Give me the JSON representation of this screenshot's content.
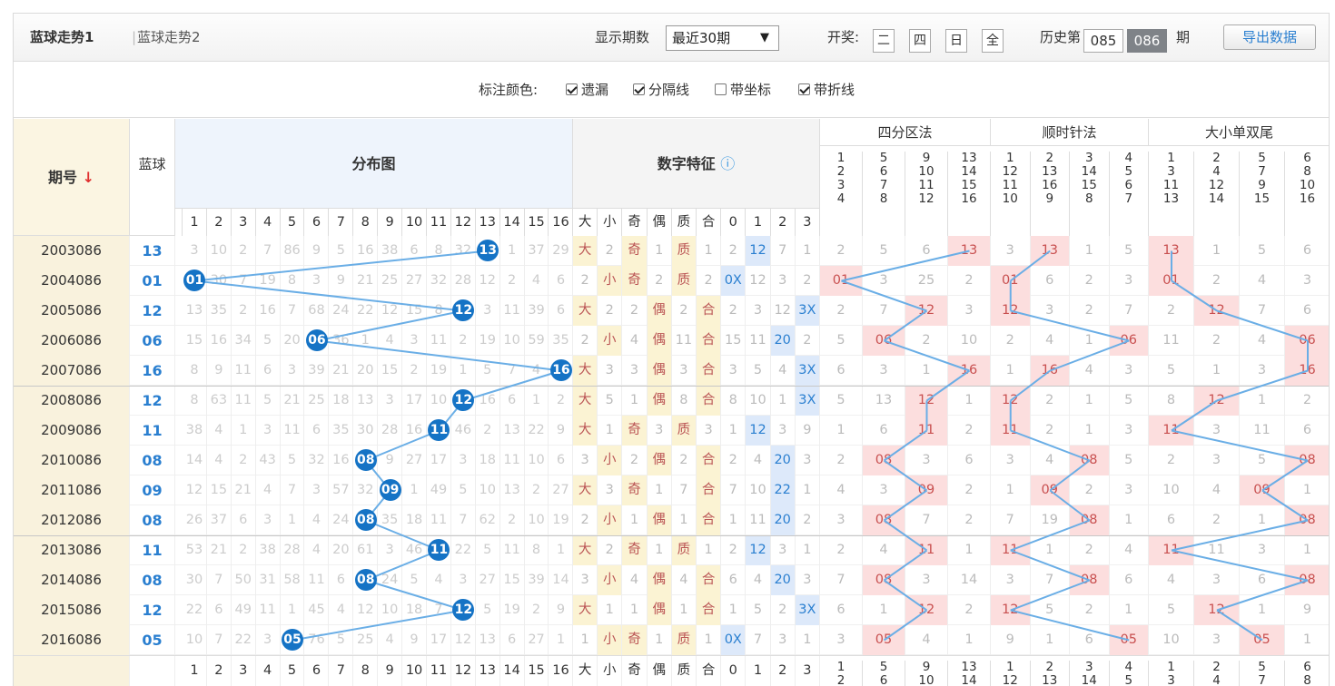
{
  "tabs": [
    "蓝球走势1",
    "蓝球走势2"
  ],
  "display": {
    "label": "显示期数",
    "value": "最近30期"
  },
  "draw": {
    "label": "开奖:",
    "days": [
      "二",
      "四",
      "日",
      "全"
    ]
  },
  "history": {
    "label": "历史第",
    "boxes": [
      "085",
      "086"
    ],
    "suffix": "期"
  },
  "export": "导出数据",
  "options": {
    "label": "标注颜色:",
    "items": [
      {
        "label": "遗漏",
        "on": true
      },
      {
        "label": "分隔线",
        "on": true
      },
      {
        "label": "带坐标",
        "on": false
      },
      {
        "label": "带折线",
        "on": true
      }
    ]
  },
  "header": {
    "period": "期号",
    "blue": "蓝球",
    "dist": "分布图",
    "feat": "数字特征",
    "zone4": "四分区法",
    "clock": "顺时针法",
    "bigsmall": "大小单双尾",
    "nums": [
      "1",
      "2",
      "3",
      "4",
      "5",
      "6",
      "7",
      "8",
      "9",
      "10",
      "11",
      "12",
      "13",
      "14",
      "15",
      "16"
    ],
    "feats": [
      "大",
      "小",
      "奇",
      "偶",
      "质",
      "合",
      "0",
      "1",
      "2",
      "3"
    ],
    "zones4": [
      [
        "1",
        "2",
        "3",
        "4"
      ],
      [
        "5",
        "6",
        "7",
        "8"
      ],
      [
        "9",
        "10",
        "11",
        "12"
      ],
      [
        "13",
        "14",
        "15",
        "16"
      ]
    ],
    "clocks": [
      [
        "1",
        "12",
        "11",
        "10"
      ],
      [
        "2",
        "13",
        "16",
        "9"
      ],
      [
        "3",
        "14",
        "15",
        "8"
      ],
      [
        "4",
        "5",
        "6",
        "7"
      ]
    ],
    "tails": [
      [
        "1",
        "3",
        "11",
        "13"
      ],
      [
        "2",
        "4",
        "12",
        "14"
      ],
      [
        "5",
        "7",
        "9",
        "15"
      ],
      [
        "6",
        "8",
        "10",
        "16"
      ]
    ]
  },
  "rows": [
    {
      "p": "2003086",
      "b": "13",
      "d": [
        "3",
        "10",
        "2",
        "7",
        "86",
        "9",
        "5",
        "16",
        "38",
        "6",
        "8",
        "32",
        "13",
        "1",
        "37",
        "29"
      ],
      "f": [
        "大",
        "2",
        "奇",
        "1",
        "质",
        "1",
        "2",
        "12",
        "7",
        "1"
      ],
      "z": [
        "2",
        "5",
        "6",
        "13"
      ],
      "c": [
        "3",
        "13",
        "1",
        "5"
      ],
      "t": [
        "13",
        "1",
        "5",
        "6"
      ]
    },
    {
      "p": "2004086",
      "b": "01",
      "d": [
        "01",
        "30",
        "7",
        "19",
        "8",
        "3",
        "9",
        "21",
        "25",
        "27",
        "32",
        "28",
        "12",
        "2",
        "4",
        "6"
      ],
      "f": [
        "2",
        "小",
        "奇",
        "2",
        "质",
        "2",
        "0X",
        "12",
        "3",
        "2"
      ],
      "z": [
        "01",
        "3",
        "25",
        "2"
      ],
      "c": [
        "01",
        "6",
        "2",
        "3"
      ],
      "t": [
        "01",
        "2",
        "4",
        "3"
      ]
    },
    {
      "p": "2005086",
      "b": "12",
      "d": [
        "13",
        "35",
        "2",
        "16",
        "7",
        "68",
        "24",
        "22",
        "12",
        "15",
        "8",
        "12",
        "3",
        "11",
        "39",
        "6"
      ],
      "f": [
        "大",
        "2",
        "2",
        "偶",
        "2",
        "合",
        "2",
        "3",
        "12",
        "3X"
      ],
      "z": [
        "2",
        "7",
        "12",
        "3"
      ],
      "c": [
        "12",
        "3",
        "2",
        "7"
      ],
      "t": [
        "2",
        "12",
        "7",
        "6"
      ]
    },
    {
      "p": "2006086",
      "b": "06",
      "d": [
        "15",
        "16",
        "34",
        "5",
        "20",
        "06",
        "36",
        "1",
        "4",
        "3",
        "11",
        "2",
        "19",
        "10",
        "59",
        "35"
      ],
      "f": [
        "2",
        "小",
        "4",
        "偶",
        "11",
        "合",
        "15",
        "11",
        "20",
        "2"
      ],
      "z": [
        "5",
        "06",
        "2",
        "10"
      ],
      "c": [
        "2",
        "4",
        "1",
        "06"
      ],
      "t": [
        "11",
        "2",
        "4",
        "06"
      ]
    },
    {
      "p": "2007086",
      "b": "16",
      "d": [
        "8",
        "9",
        "11",
        "6",
        "3",
        "39",
        "21",
        "20",
        "15",
        "2",
        "19",
        "1",
        "5",
        "7",
        "4",
        "16"
      ],
      "f": [
        "大",
        "3",
        "3",
        "偶",
        "3",
        "合",
        "3",
        "5",
        "4",
        "3X"
      ],
      "z": [
        "6",
        "3",
        "1",
        "16"
      ],
      "c": [
        "1",
        "16",
        "4",
        "3"
      ],
      "t": [
        "5",
        "1",
        "3",
        "16"
      ]
    },
    {
      "p": "2008086",
      "b": "12",
      "d": [
        "8",
        "63",
        "11",
        "5",
        "21",
        "25",
        "18",
        "13",
        "3",
        "17",
        "10",
        "12",
        "16",
        "6",
        "1",
        "2"
      ],
      "f": [
        "大",
        "5",
        "1",
        "偶",
        "8",
        "合",
        "8",
        "10",
        "1",
        "3X"
      ],
      "z": [
        "5",
        "13",
        "12",
        "1"
      ],
      "c": [
        "12",
        "2",
        "1",
        "5"
      ],
      "t": [
        "8",
        "12",
        "1",
        "2"
      ]
    },
    {
      "p": "2009086",
      "b": "11",
      "d": [
        "38",
        "4",
        "1",
        "3",
        "11",
        "6",
        "35",
        "30",
        "28",
        "16",
        "11",
        "46",
        "2",
        "13",
        "22",
        "9"
      ],
      "f": [
        "大",
        "1",
        "奇",
        "3",
        "质",
        "3",
        "1",
        "12",
        "3",
        "9"
      ],
      "z": [
        "1",
        "6",
        "11",
        "2"
      ],
      "c": [
        "11",
        "2",
        "1",
        "3"
      ],
      "t": [
        "11",
        "3",
        "11",
        "6"
      ]
    },
    {
      "p": "2010086",
      "b": "08",
      "d": [
        "14",
        "4",
        "2",
        "43",
        "5",
        "32",
        "16",
        "08",
        "9",
        "27",
        "17",
        "3",
        "18",
        "11",
        "10",
        "6"
      ],
      "f": [
        "3",
        "小",
        "2",
        "偶",
        "2",
        "合",
        "2",
        "4",
        "20",
        "3"
      ],
      "z": [
        "2",
        "08",
        "3",
        "6"
      ],
      "c": [
        "3",
        "4",
        "08",
        "5"
      ],
      "t": [
        "2",
        "3",
        "5",
        "08"
      ]
    },
    {
      "p": "2011086",
      "b": "09",
      "d": [
        "12",
        "15",
        "21",
        "4",
        "7",
        "3",
        "57",
        "32",
        "09",
        "1",
        "49",
        "5",
        "10",
        "13",
        "2",
        "27"
      ],
      "f": [
        "大",
        "3",
        "奇",
        "1",
        "7",
        "合",
        "7",
        "10",
        "22",
        "1"
      ],
      "z": [
        "4",
        "3",
        "09",
        "2"
      ],
      "c": [
        "1",
        "09",
        "2",
        "3"
      ],
      "t": [
        "10",
        "4",
        "09",
        "1"
      ]
    },
    {
      "p": "2012086",
      "b": "08",
      "d": [
        "26",
        "37",
        "6",
        "3",
        "1",
        "4",
        "24",
        "08",
        "35",
        "18",
        "11",
        "7",
        "62",
        "2",
        "10",
        "19"
      ],
      "f": [
        "2",
        "小",
        "1",
        "偶",
        "1",
        "合",
        "1",
        "11",
        "20",
        "2"
      ],
      "z": [
        "3",
        "08",
        "7",
        "2"
      ],
      "c": [
        "7",
        "19",
        "08",
        "1"
      ],
      "t": [
        "6",
        "2",
        "1",
        "08"
      ]
    },
    {
      "p": "2013086",
      "b": "11",
      "d": [
        "53",
        "21",
        "2",
        "38",
        "28",
        "4",
        "20",
        "61",
        "3",
        "46",
        "11",
        "22",
        "5",
        "11",
        "8",
        "1"
      ],
      "f": [
        "大",
        "2",
        "奇",
        "1",
        "质",
        "1",
        "2",
        "12",
        "3",
        "1"
      ],
      "z": [
        "2",
        "4",
        "11",
        "1"
      ],
      "c": [
        "11",
        "1",
        "2",
        "4"
      ],
      "t": [
        "11",
        "11",
        "3",
        "1"
      ]
    },
    {
      "p": "2014086",
      "b": "08",
      "d": [
        "30",
        "7",
        "50",
        "31",
        "58",
        "11",
        "6",
        "08",
        "24",
        "5",
        "4",
        "3",
        "27",
        "15",
        "39",
        "14"
      ],
      "f": [
        "3",
        "小",
        "4",
        "偶",
        "4",
        "合",
        "6",
        "4",
        "20",
        "3"
      ],
      "z": [
        "7",
        "08",
        "3",
        "14"
      ],
      "c": [
        "3",
        "7",
        "08",
        "6"
      ],
      "t": [
        "4",
        "3",
        "6",
        "08"
      ]
    },
    {
      "p": "2015086",
      "b": "12",
      "d": [
        "22",
        "6",
        "49",
        "11",
        "1",
        "45",
        "4",
        "12",
        "10",
        "18",
        "7",
        "12",
        "5",
        "19",
        "2",
        "9"
      ],
      "f": [
        "大",
        "1",
        "1",
        "偶",
        "1",
        "合",
        "1",
        "5",
        "2",
        "3X"
      ],
      "z": [
        "6",
        "1",
        "12",
        "2"
      ],
      "c": [
        "12",
        "5",
        "2",
        "1"
      ],
      "t": [
        "5",
        "12",
        "1",
        "9"
      ]
    },
    {
      "p": "2016086",
      "b": "05",
      "d": [
        "10",
        "7",
        "22",
        "3",
        "05",
        "76",
        "5",
        "25",
        "4",
        "9",
        "17",
        "12",
        "13",
        "6",
        "27",
        "1"
      ],
      "f": [
        "1",
        "小",
        "奇",
        "1",
        "质",
        "1",
        "0X",
        "7",
        "3",
        "1"
      ],
      "z": [
        "3",
        "05",
        "4",
        "1"
      ],
      "c": [
        "9",
        "1",
        "6",
        "05"
      ],
      "t": [
        "10",
        "3",
        "05",
        "1"
      ]
    }
  ],
  "hits": {
    "ball": [
      13,
      1,
      12,
      6,
      16,
      12,
      11,
      8,
      9,
      8,
      11,
      8,
      12,
      5
    ],
    "feat": [
      [
        0,
        2,
        4,
        7
      ],
      [
        1,
        2,
        4,
        6
      ],
      [
        0,
        3,
        5,
        9
      ],
      [
        1,
        3,
        5,
        8
      ],
      [
        0,
        3,
        5,
        9
      ],
      [
        0,
        3,
        5,
        9
      ],
      [
        0,
        2,
        4,
        7
      ],
      [
        1,
        3,
        5,
        8
      ],
      [
        0,
        2,
        5,
        8
      ],
      [
        1,
        3,
        5,
        8
      ],
      [
        0,
        2,
        4,
        7
      ],
      [
        1,
        3,
        5,
        8
      ],
      [
        0,
        3,
        5,
        9
      ],
      [
        1,
        2,
        4,
        6
      ]
    ],
    "zone": [
      3,
      0,
      2,
      1,
      3,
      2,
      2,
      1,
      2,
      1,
      2,
      1,
      2,
      1
    ],
    "clock": [
      1,
      0,
      0,
      3,
      1,
      0,
      0,
      2,
      1,
      2,
      0,
      2,
      0,
      3
    ],
    "tail": [
      0,
      0,
      1,
      3,
      3,
      1,
      0,
      3,
      2,
      3,
      0,
      3,
      1,
      2
    ]
  },
  "colors": {
    "ball": "#1573c5",
    "line": "#6aaee6",
    "pink": "#fcdede",
    "yellow": "#fbf3d3",
    "lightblue": "#dde9fa"
  }
}
